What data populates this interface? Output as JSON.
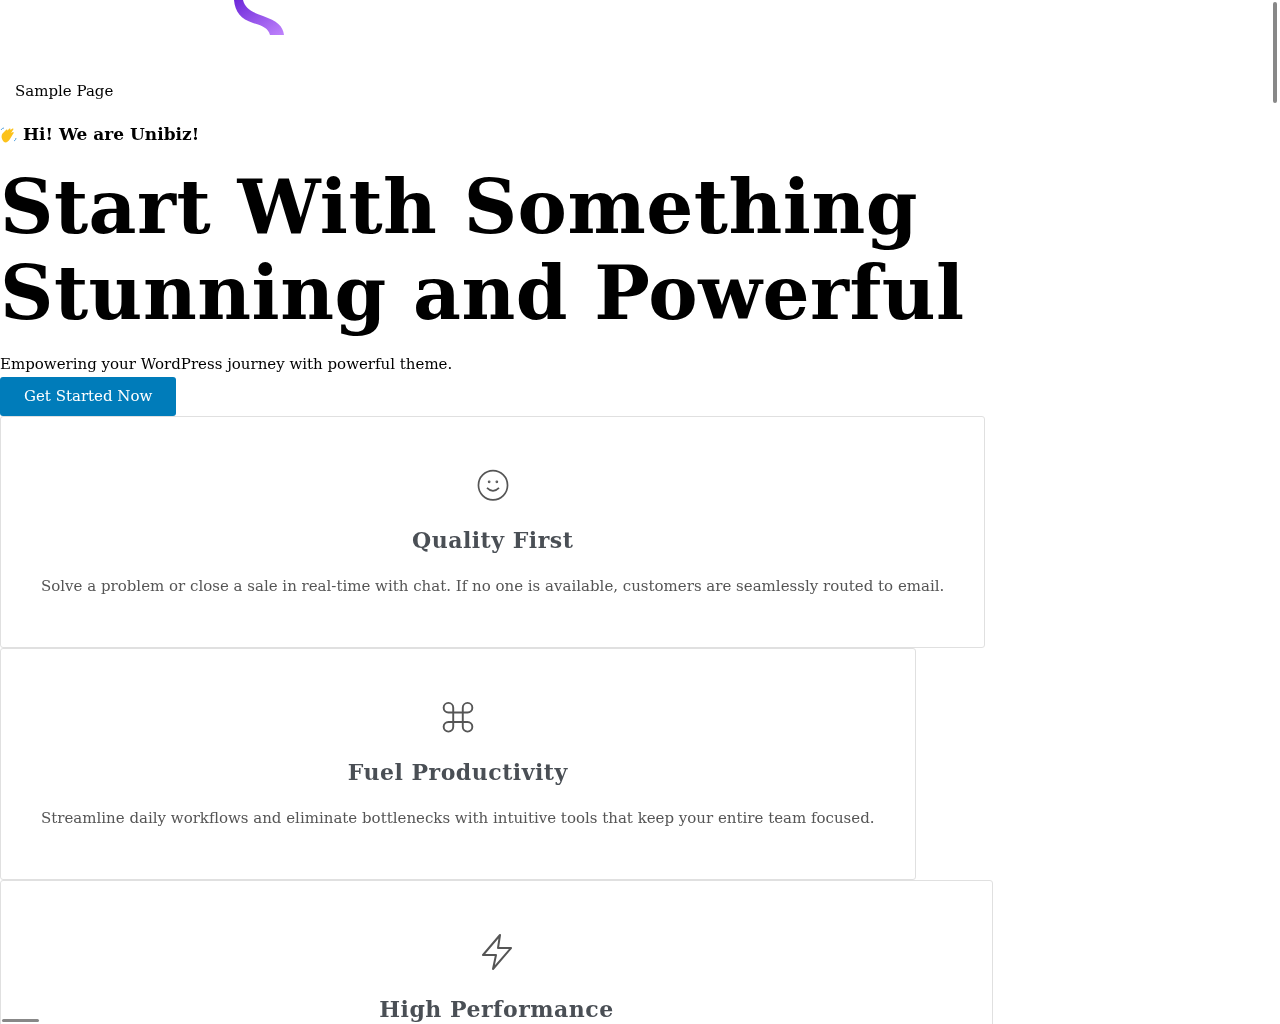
{
  "nav": {
    "items": [
      "Sample Page"
    ]
  },
  "hero": {
    "eyebrow": "Hi! We are Unibiz!",
    "title_lines": [
      "Start With Something",
      "Stunning and Powerful"
    ],
    "subtitle": "Empowering your WordPress journey with powerful theme.",
    "button": "Get Started Now"
  },
  "features": [
    {
      "kind": "smile",
      "title": "Quality First",
      "text": "Solve a problem or close a sale in real-time with chat. If no one is available, customers are seamlessly routed to email."
    },
    {
      "kind": "command",
      "title": "Fuel Productivity",
      "text": "Streamline daily workflows and eliminate bottlenecks with intuitive tools that keep your entire team focused."
    },
    {
      "kind": "bolt",
      "title": "High Performance"
    }
  ]
}
